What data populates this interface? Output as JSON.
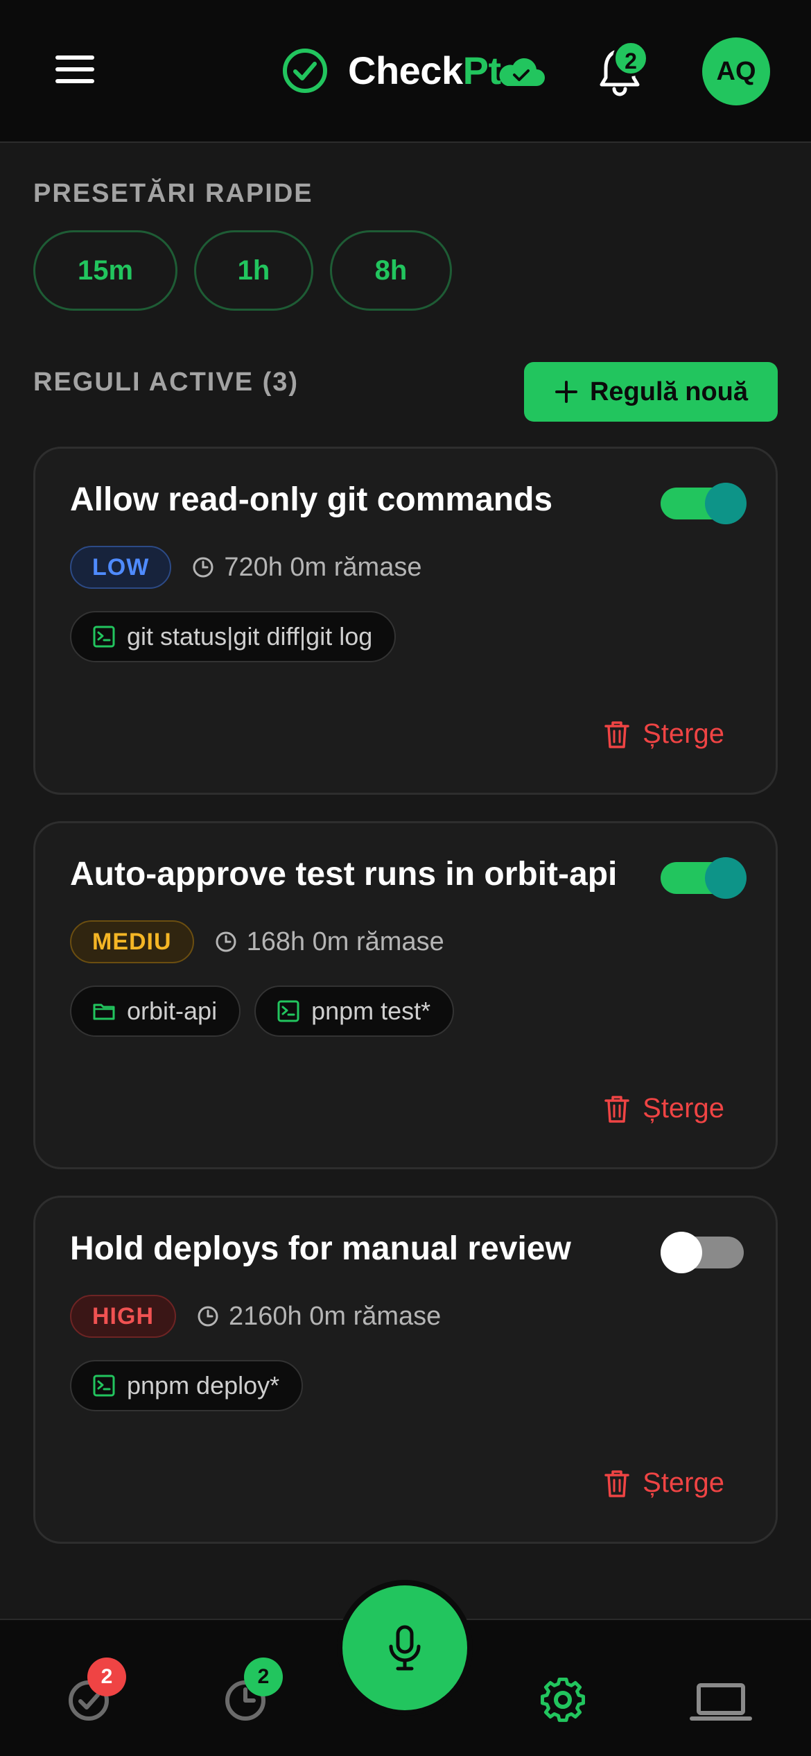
{
  "app": {
    "name_main": "Check",
    "name_accent": "Pt",
    "notifications_count": "2",
    "avatar_initials": "AQ",
    "colors": {
      "accent": "#22c55e",
      "danger": "#ef4444",
      "background": "#181818",
      "header": "#0b0b0b"
    }
  },
  "presets": {
    "title": "PRESETĂRI RAPIDE",
    "items": [
      "15m",
      "1h",
      "8h"
    ]
  },
  "rules": {
    "title": "REGULI ACTIVE (3)",
    "new_button": "Regulă nouă",
    "delete_label": "Șterge",
    "items": [
      {
        "title": "Allow read-only git commands",
        "enabled": true,
        "severity": "LOW",
        "remaining": "720h 0m rămase",
        "chips": [
          {
            "icon": "terminal-icon",
            "text": "git status|git diff|git log"
          }
        ]
      },
      {
        "title": "Auto-approve test runs in orbit-api",
        "enabled": true,
        "severity": "MEDIU",
        "remaining": "168h 0m rămase",
        "chips": [
          {
            "icon": "folder-icon",
            "text": "orbit-api"
          },
          {
            "icon": "terminal-icon",
            "text": "pnpm test*"
          }
        ]
      },
      {
        "title": "Hold deploys for manual review",
        "enabled": false,
        "severity": "HIGH",
        "remaining": "2160h 0m rămase",
        "chips": [
          {
            "icon": "terminal-icon",
            "text": "pnpm deploy*"
          }
        ]
      }
    ]
  },
  "bottom_nav": {
    "approvals_badge": "2",
    "history_badge": "2",
    "items": [
      "approvals-icon",
      "history-icon",
      "microphone-icon",
      "settings-icon",
      "laptop-icon"
    ]
  }
}
